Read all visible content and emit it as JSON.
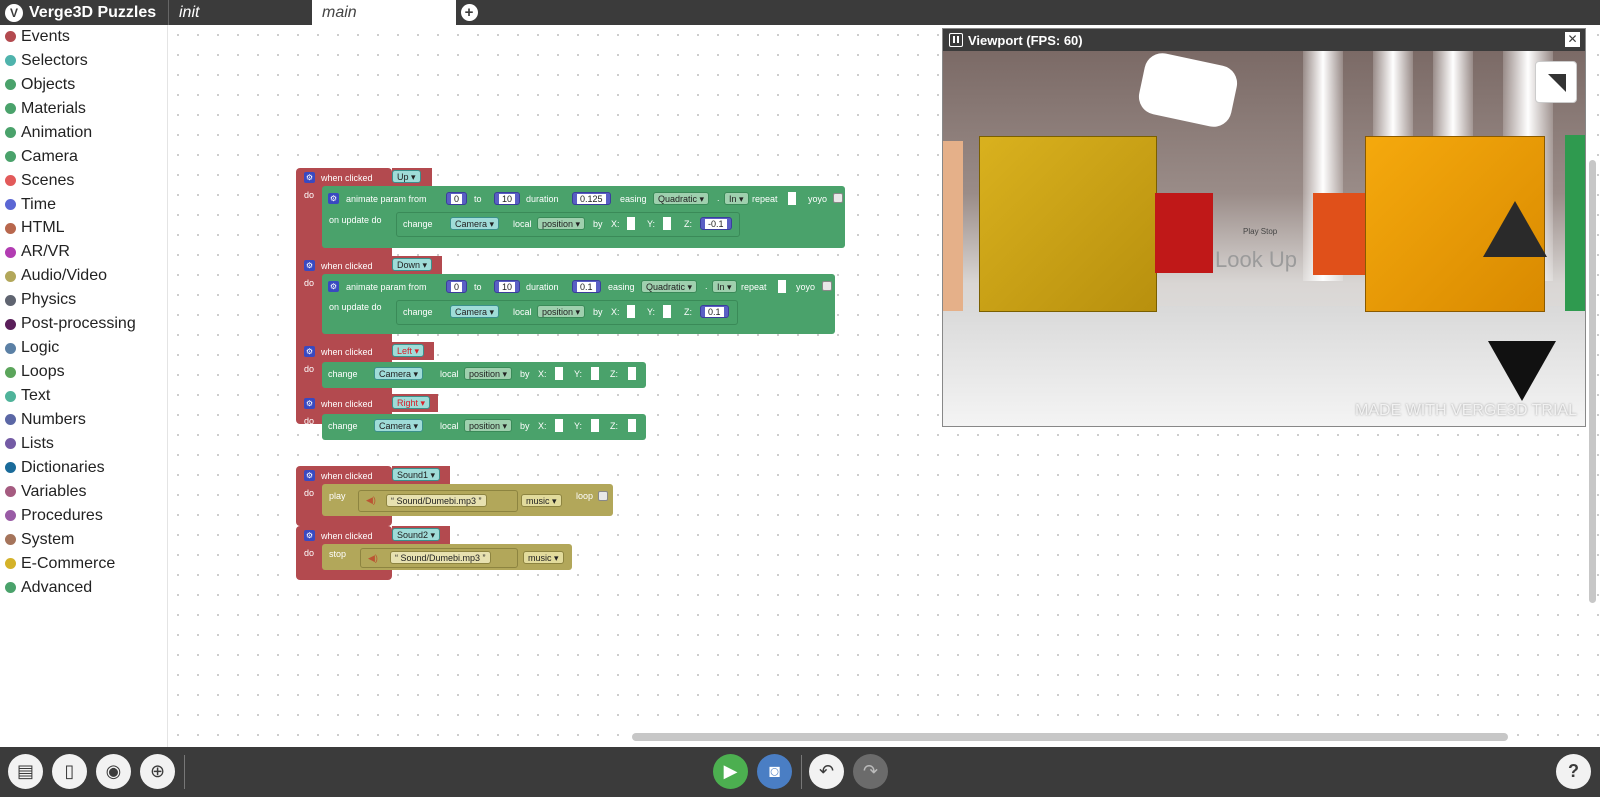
{
  "app": {
    "title": "Verge3D Puzzles"
  },
  "tabs": [
    {
      "label": "init"
    },
    {
      "label": "main"
    }
  ],
  "categories": [
    {
      "label": "Events",
      "color": "#b34a4f"
    },
    {
      "label": "Selectors",
      "color": "#4fb3ac"
    },
    {
      "label": "Objects",
      "color": "#4aa26b"
    },
    {
      "label": "Materials",
      "color": "#4aa26b"
    },
    {
      "label": "Animation",
      "color": "#4aa26b"
    },
    {
      "label": "Camera",
      "color": "#4aa26b"
    },
    {
      "label": "Scenes",
      "color": "#e25a5a"
    },
    {
      "label": "Time",
      "color": "#5b67d4"
    },
    {
      "label": "HTML",
      "color": "#b8674d"
    },
    {
      "label": "AR/VR",
      "color": "#b23cb2"
    },
    {
      "label": "Audio/Video",
      "color": "#b2a75a"
    },
    {
      "label": "Physics",
      "color": "#5f6470"
    },
    {
      "label": "Post-processing",
      "color": "#5a1f5a"
    },
    {
      "label": "Logic",
      "color": "#5b80a5"
    },
    {
      "label": "Loops",
      "color": "#5ba55b"
    },
    {
      "label": "Text",
      "color": "#4fb39a"
    },
    {
      "label": "Numbers",
      "color": "#5b67a5"
    },
    {
      "label": "Lists",
      "color": "#745ba5"
    },
    {
      "label": "Dictionaries",
      "color": "#1a6b9a"
    },
    {
      "label": "Variables",
      "color": "#a55b80"
    },
    {
      "label": "Procedures",
      "color": "#995ba5"
    },
    {
      "label": "System",
      "color": "#a5745b"
    },
    {
      "label": "E-Commerce",
      "color": "#d4b229"
    },
    {
      "label": "Advanced",
      "color": "#4aa26b"
    }
  ],
  "blocks": {
    "when_clicked": "when clicked",
    "do": "do",
    "animate_from": "animate param from",
    "to": "to",
    "duration": "duration",
    "easing": "easing",
    "repeat": "repeat",
    "yoyo": "yoyo",
    "on_update_do": "on update do",
    "change": "change",
    "local": "local",
    "by": "by",
    "x": "X:",
    "y": "Y:",
    "z": "Z:",
    "play": "play",
    "stop": "stop",
    "loop": "loop",
    "camera": "Camera",
    "position": "position",
    "quadratic": "Quadratic",
    "in": "In",
    "up": "Up",
    "down": "Down",
    "left": "Left",
    "right": "Right",
    "sound1": "Sound1",
    "sound2": "Sound2",
    "from_val": "0",
    "to_val": "10",
    "dur_up": "0.125",
    "dur_down": "0.1",
    "z_up": "-0.1",
    "z_down": "0.1",
    "sound_file": "Sound/Dumebi.mp3",
    "music": "music"
  },
  "viewport": {
    "title": "Viewport (FPS: 60)",
    "watermark": "MADE WITH VERGE3D TRIAL",
    "look_up": "Look Up",
    "play": "Play",
    "stop": "Stop"
  }
}
